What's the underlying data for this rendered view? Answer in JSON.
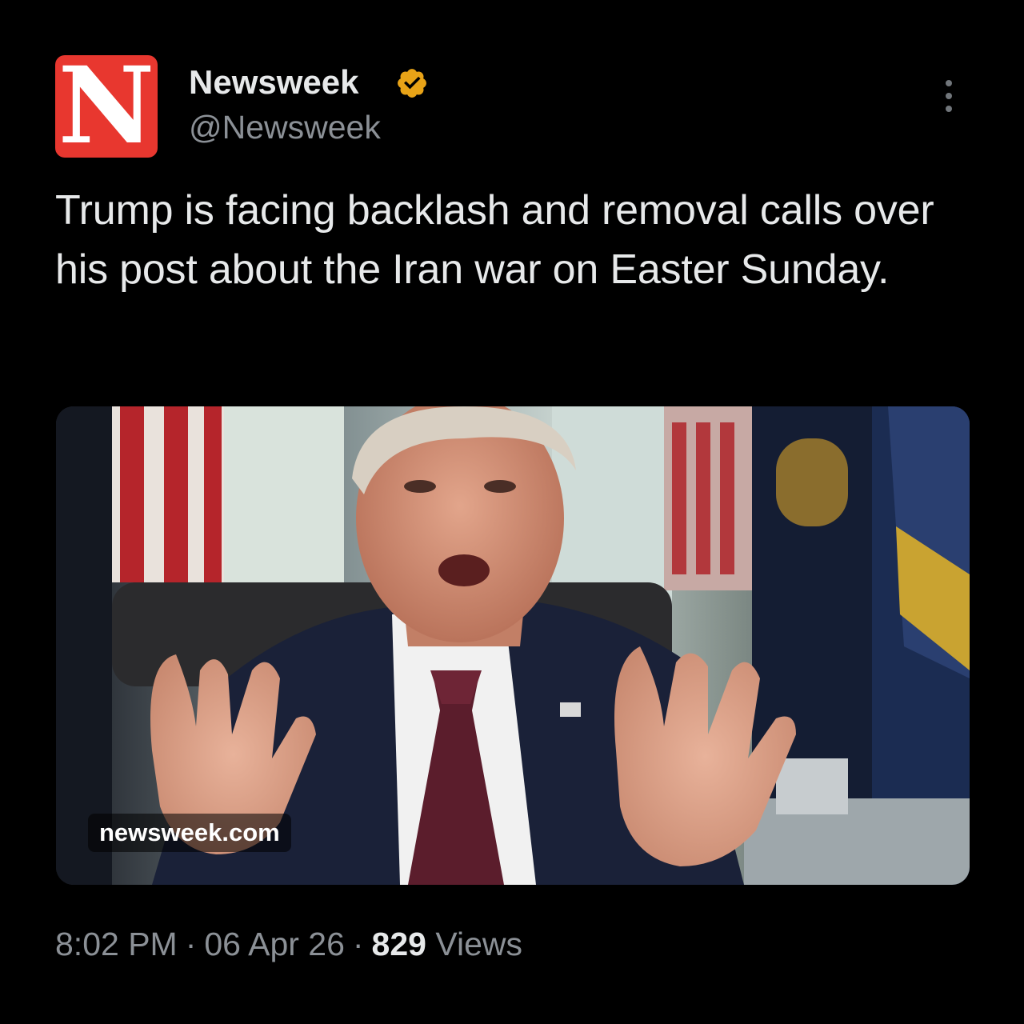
{
  "post": {
    "author": {
      "avatar_letter": "N",
      "name": "Newsweek",
      "handle": "@Newsweek",
      "verified_icon": "verified-badge-icon",
      "avatar_color": "#e8372f",
      "badge_color": "#e8a317"
    },
    "more_icon": "more-options-icon",
    "text": "Trump is facing backlash and removal calls over his post about the Iran war on Easter Sunday.",
    "media": {
      "domain": "newsweek.com"
    },
    "meta": {
      "time": "8:02 PM",
      "separator": "·",
      "date": "06 Apr 26",
      "views_count": "829",
      "views_label": "Views"
    }
  }
}
